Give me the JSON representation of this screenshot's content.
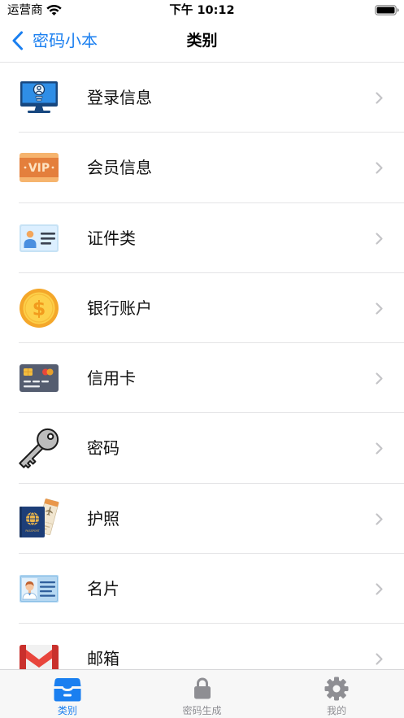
{
  "status_bar": {
    "carrier": "运营商",
    "time": "下午 10:12",
    "wifi_icon": "wifi-icon",
    "battery_icon": "battery-icon"
  },
  "nav": {
    "back_icon": "chevron-left-icon",
    "back_label": "密码小本",
    "title": "类别"
  },
  "categories": [
    {
      "label": "登录信息",
      "icon": "monitor-user-icon"
    },
    {
      "label": "会员信息",
      "icon": "vip-card-icon",
      "icon_text": "VIP"
    },
    {
      "label": "证件类",
      "icon": "id-card-icon"
    },
    {
      "label": "银行账户",
      "icon": "coin-icon",
      "icon_text": "$"
    },
    {
      "label": "信用卡",
      "icon": "credit-card-icon"
    },
    {
      "label": "密码",
      "icon": "key-icon"
    },
    {
      "label": "护照",
      "icon": "passport-icon",
      "icon_text": "PASSPORT"
    },
    {
      "label": "名片",
      "icon": "business-card-icon"
    },
    {
      "label": "邮箱",
      "icon": "gmail-icon"
    }
  ],
  "row_chevron_icon": "chevron-right-icon",
  "tabs": [
    {
      "label": "类别",
      "icon": "tray-icon",
      "active": true
    },
    {
      "label": "密码生成",
      "icon": "lock-icon",
      "active": false
    },
    {
      "label": "我的",
      "icon": "gear-icon",
      "active": false
    }
  ],
  "colors": {
    "accent": "#1a7ff0",
    "inactive": "#8e8e93",
    "text": "#111111",
    "separator": "#e4e4e6",
    "chevron": "#c4c4c7",
    "tabbar_background": "#f7f7f7"
  }
}
